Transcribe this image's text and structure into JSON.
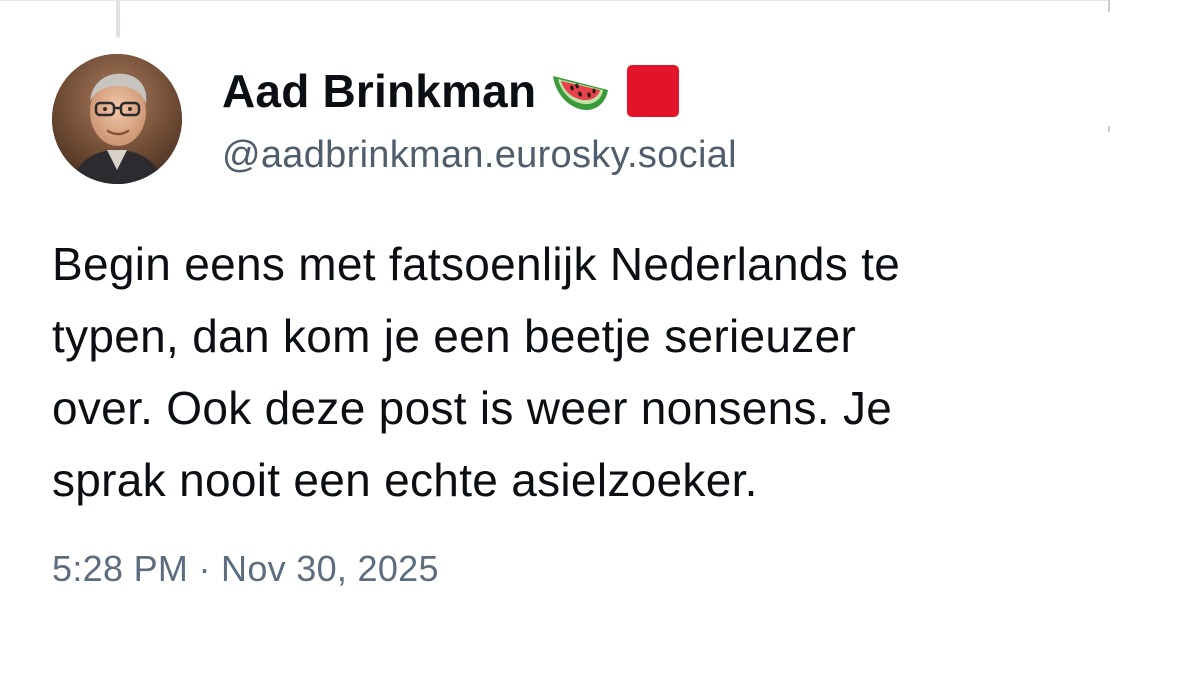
{
  "post": {
    "author_name": "Aad Brinkman",
    "author_handle": "@aadbrinkman.eurosky.social",
    "badges": [
      "watermelon-icon",
      "red-square-icon"
    ],
    "text": "Begin eens met fatsoenlijk Nederlands te\ntypen, dan kom je een beetje serieuzer\nover. Ook deze post is weer nonsens. Je\nsprak nooit een echte asielzoeker.",
    "timestamp": "5:28 PM · Nov 30, 2025"
  },
  "colors": {
    "text_primary": "#0b0f14",
    "text_secondary": "#5c6d80",
    "badge_red": "#e3132a",
    "watermelon_green": "#3b9b3a",
    "watermelon_red": "#e8424c"
  }
}
